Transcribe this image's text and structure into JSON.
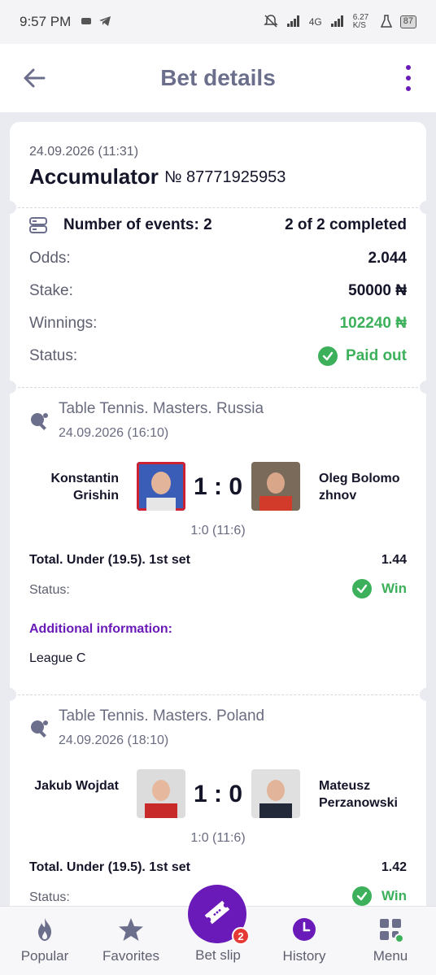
{
  "status_bar": {
    "time": "9:57 PM",
    "network": "4G",
    "speed": "6.27 K/S",
    "battery": "87"
  },
  "header": {
    "title": "Bet details"
  },
  "bet": {
    "date": "24.09.2026 (11:31)",
    "type": "Accumulator",
    "number": "№ 87771925953",
    "events_label": "Number of events: 2",
    "events_completed": "2 of 2 completed",
    "odds_label": "Odds:",
    "odds_value": "2.044",
    "stake_label": "Stake:",
    "stake_value": "50000 ₦",
    "winnings_label": "Winnings:",
    "winnings_value": "102240 ₦",
    "status_label": "Status:",
    "status_value": "Paid out"
  },
  "events": [
    {
      "league": "Table Tennis. Masters. Russia",
      "date": "24.09.2026 (16:10)",
      "player1": "Konstantin Grishin",
      "player2": "Oleg Bolomo zhnov",
      "score": "1 : 0",
      "subscore": "1:0 (11:6)",
      "market": "Total. Under (19.5). 1st set",
      "odds": "1.44",
      "status_label": "Status:",
      "status_value": "Win",
      "additional_label": "Additional information:",
      "additional_value": "League C"
    },
    {
      "league": "Table Tennis. Masters. Poland",
      "date": "24.09.2026 (18:10)",
      "player1": "Jakub Wojdat",
      "player2": "Mateusz Perzanowski",
      "score": "1 : 0",
      "subscore": "1:0 (11:6)",
      "market": "Total. Under (19.5). 1st set",
      "odds": "1.42",
      "status_label": "Status:",
      "status_value": "Win"
    }
  ],
  "nav": {
    "popular": "Popular",
    "favorites": "Favorites",
    "betslip": "Bet slip",
    "betslip_count": "2",
    "history": "History",
    "menu": "Menu"
  },
  "colors": {
    "accent": "#6a1ab8",
    "win": "#3cb05b",
    "header_title": "#6c6f8c"
  }
}
